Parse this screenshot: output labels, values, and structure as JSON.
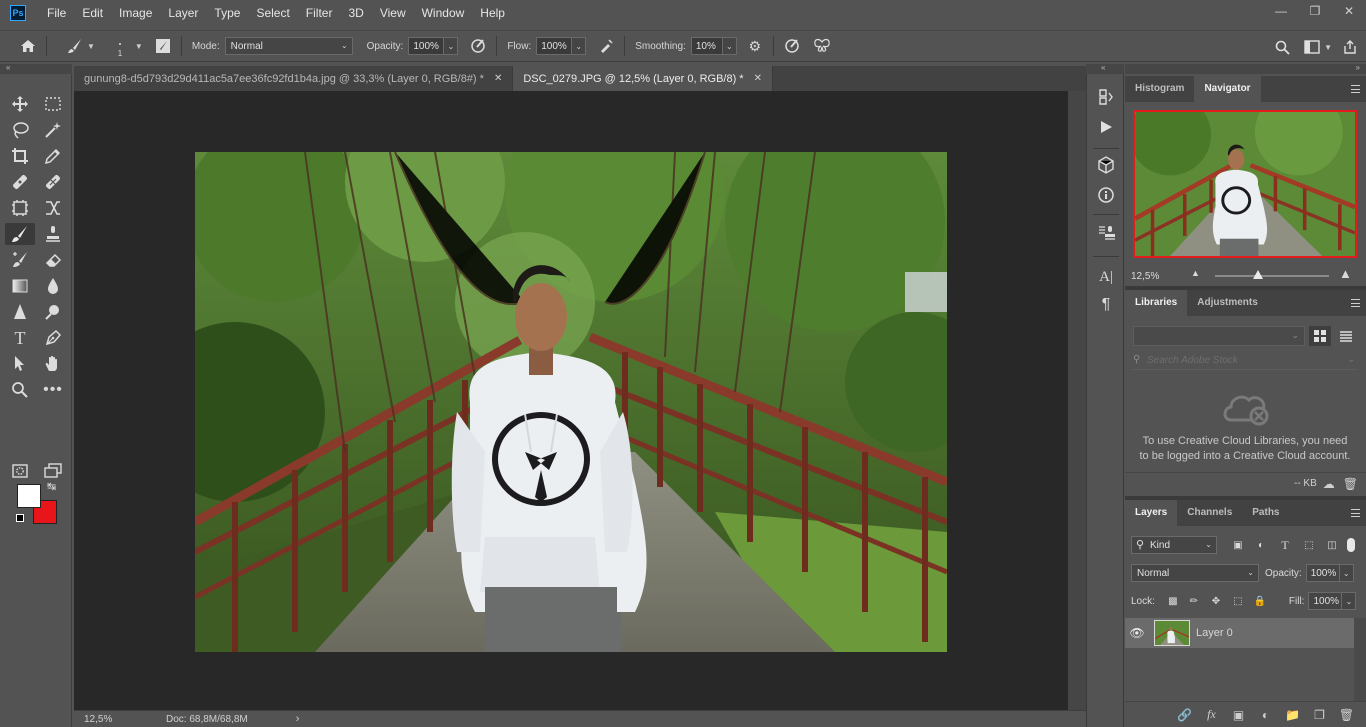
{
  "app": {
    "logo": "Ps"
  },
  "menu": [
    "File",
    "Edit",
    "Image",
    "Layer",
    "Type",
    "Select",
    "Filter",
    "3D",
    "View",
    "Window",
    "Help"
  ],
  "options": {
    "brush_size": "1",
    "mode_label": "Mode:",
    "mode_value": "Normal",
    "opacity_label": "Opacity:",
    "opacity_value": "100%",
    "flow_label": "Flow:",
    "flow_value": "100%",
    "smoothing_label": "Smoothing:",
    "smoothing_value": "10%"
  },
  "tabs": [
    {
      "label": "gunung8-d5d793d29d411ac5a7ee36fc92fd1b4a.jpg @ 33,3% (Layer 0, RGB/8#) *"
    },
    {
      "label": "DSC_0279.JPG @ 12,5% (Layer 0, RGB/8) *"
    }
  ],
  "status": {
    "zoom": "12,5%",
    "doc": "Doc: 68,8M/68,8M"
  },
  "colors": {
    "foreground": "#ffffff",
    "background": "#e8151b",
    "accent_red": "#e21c1c"
  },
  "navigator": {
    "tabs": [
      "Histogram",
      "Navigator"
    ],
    "zoom": "12,5%",
    "zoom_fraction": 0.38
  },
  "libraries": {
    "tabs": [
      "Libraries",
      "Adjustments"
    ],
    "search_placeholder": "Search Adobe Stock",
    "message": "To use Creative Cloud Libraries, you need to be logged into a Creative Cloud account.",
    "size": "-- KB"
  },
  "layers": {
    "tabs": [
      "Layers",
      "Channels",
      "Paths"
    ],
    "filter_kind": "Kind",
    "blend_mode": "Normal",
    "opacity_label": "Opacity:",
    "opacity_value": "100%",
    "lock_label": "Lock:",
    "fill_label": "Fill:",
    "fill_value": "100%",
    "items": [
      {
        "name": "Layer 0",
        "visible": true
      }
    ]
  }
}
